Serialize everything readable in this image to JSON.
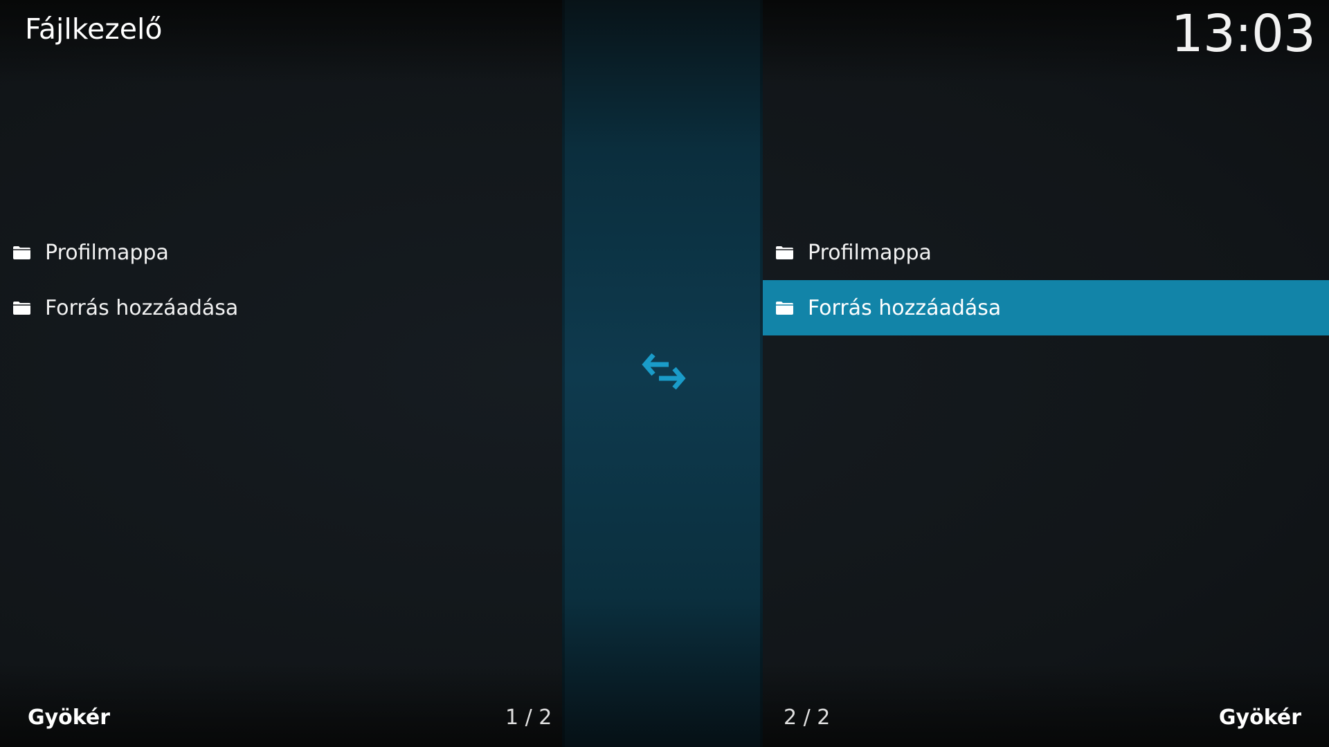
{
  "header": {
    "title": "Fájlkezelő",
    "clock": "13:03"
  },
  "left_pane": {
    "items": [
      {
        "label": "Profilmappa",
        "icon": "folder-icon"
      },
      {
        "label": "Forrás hozzáadása",
        "icon": "folder-icon"
      }
    ],
    "path": "Gyökér",
    "page": "1 / 2"
  },
  "right_pane": {
    "items": [
      {
        "label": "Profilmappa",
        "icon": "folder-icon"
      },
      {
        "label": "Forrás hozzáadása",
        "icon": "folder-icon",
        "selected": true
      }
    ],
    "path": "Gyökér",
    "page": "2 / 2"
  },
  "center": {
    "icon": "swap-arrows-icon"
  },
  "colors": {
    "accent": "#1284a8",
    "background": "#121619",
    "center_strip": "#0e3a4e"
  }
}
